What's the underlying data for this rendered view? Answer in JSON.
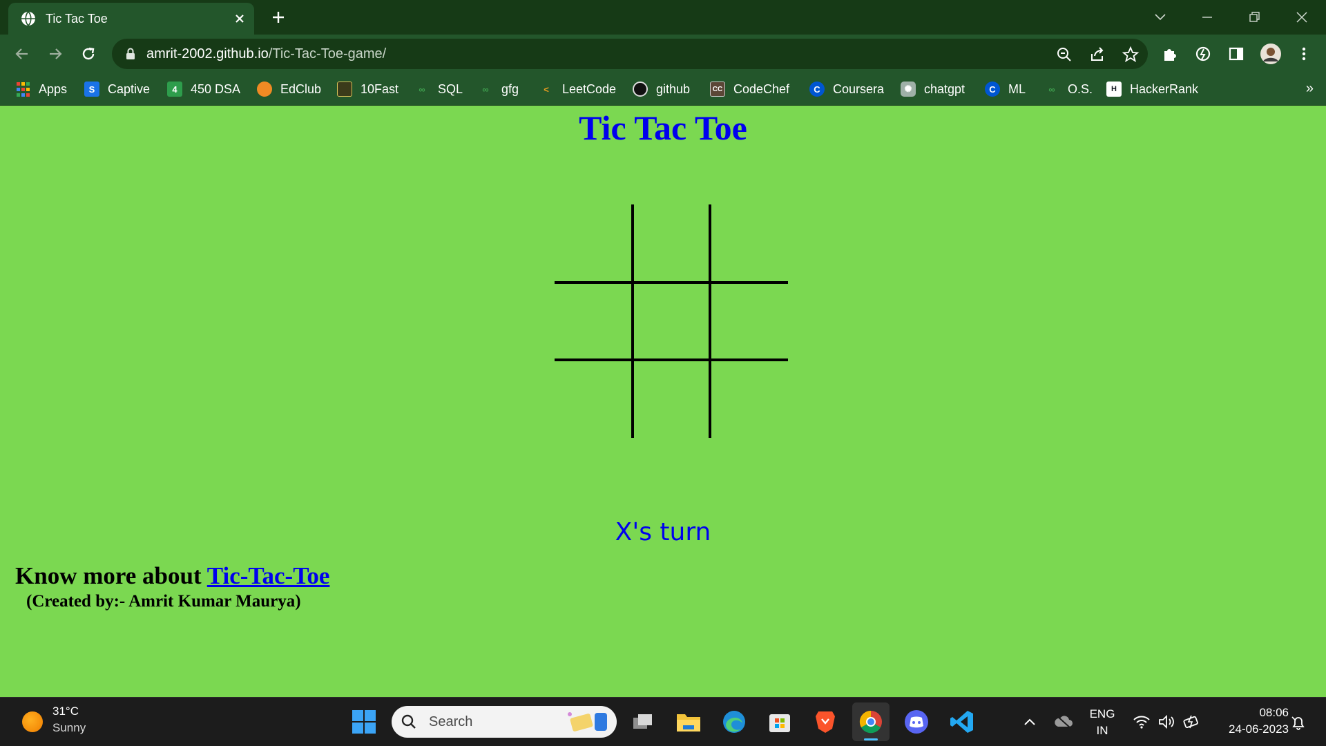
{
  "browser": {
    "tab_title": "Tic Tac Toe",
    "url_host": "amrit-2002.github.io",
    "url_path": "/Tic-Tac-Toe-game/"
  },
  "bookmarks": [
    {
      "label": "Apps",
      "icon": "apps-grid-icon"
    },
    {
      "label": "Captive",
      "icon": "captive-icon"
    },
    {
      "label": "450 DSA",
      "icon": "dsa-icon"
    },
    {
      "label": "EdClub",
      "icon": "edclub-icon"
    },
    {
      "label": "10Fast",
      "icon": "tenfast-icon"
    },
    {
      "label": "SQL",
      "icon": "gfg-icon"
    },
    {
      "label": "gfg",
      "icon": "gfg-icon"
    },
    {
      "label": "LeetCode",
      "icon": "leetcode-icon"
    },
    {
      "label": "github",
      "icon": "github-icon"
    },
    {
      "label": "CodeChef",
      "icon": "codechef-icon"
    },
    {
      "label": "Coursera",
      "icon": "coursera-icon"
    },
    {
      "label": "chatgpt",
      "icon": "chatgpt-icon"
    },
    {
      "label": "ML",
      "icon": "coursera-icon"
    },
    {
      "label": "O.S.",
      "icon": "gfg-icon"
    },
    {
      "label": "HackerRank",
      "icon": "hackerrank-icon"
    }
  ],
  "game": {
    "title": "Tic Tac Toe",
    "cells": [
      "",
      "",
      "",
      "",
      "",
      "",
      "",
      "",
      ""
    ],
    "turn_text": "X's turn",
    "know_more_prefix": "Know more about ",
    "know_more_link": "Tic-Tac-Toe",
    "credit": "(Created by:- Amrit Kumar Maurya)"
  },
  "taskbar": {
    "weather_temp": "31°C",
    "weather_condition": "Sunny",
    "search_placeholder": "Search",
    "lang_primary": "ENG",
    "lang_secondary": "IN",
    "time": "08:06",
    "date": "24-06-2023"
  },
  "colors": {
    "page_background": "#7bd851",
    "title_color": "#0000ee",
    "browser_frame": "#163a16",
    "browser_toolbar": "#23562b"
  }
}
